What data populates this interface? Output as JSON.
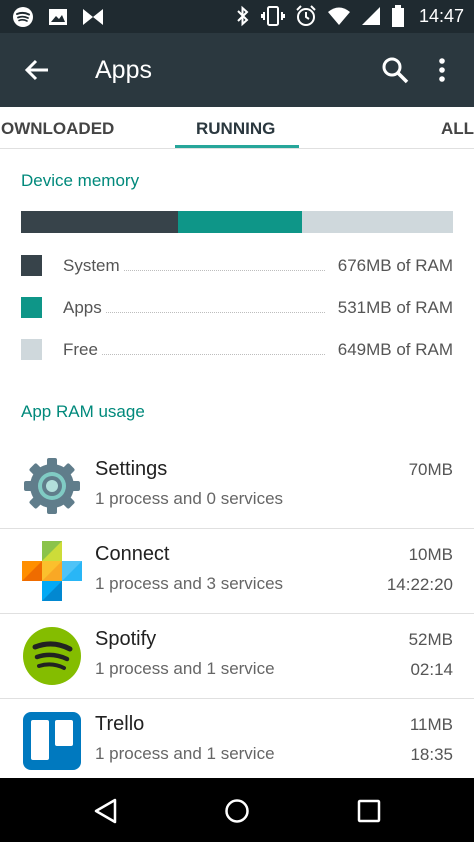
{
  "status_bar": {
    "time": "14:47",
    "left_icons": [
      "spotify-icon",
      "image-icon",
      "trello-notification-icon"
    ],
    "right_icons": [
      "bluetooth-icon",
      "vibrate-icon",
      "alarm-icon",
      "wifi-icon",
      "signal-icon",
      "battery-icon"
    ]
  },
  "toolbar": {
    "title": "Apps",
    "back_icon": "arrow-back-icon",
    "search_icon": "search-icon",
    "more_icon": "more-vert-icon"
  },
  "tabs": [
    {
      "label": "OWNLOADED"
    },
    {
      "label": "RUNNING"
    },
    {
      "label": "ALL"
    }
  ],
  "device_memory": {
    "title": "Device memory",
    "segments": [
      {
        "label": "System",
        "value": "676MB of RAM",
        "mb": 676,
        "color": "#37434a"
      },
      {
        "label": "Apps",
        "value": "531MB of RAM",
        "mb": 531,
        "color": "#0e9688"
      },
      {
        "label": "Free",
        "value": "649MB of RAM",
        "mb": 649,
        "color": "#cfd8dc"
      }
    ]
  },
  "app_ram_usage": {
    "title": "App RAM usage",
    "apps": [
      {
        "name": "Settings",
        "detail": "1 process and 0 services",
        "size": "70MB",
        "time": "",
        "icon": "settings-gear-icon"
      },
      {
        "name": "Connect",
        "detail": "1 process and 3 services",
        "size": "10MB",
        "time": "14:22:20",
        "icon": "connect-icon"
      },
      {
        "name": "Spotify",
        "detail": "1 process and 1 service",
        "size": "52MB",
        "time": "02:14",
        "icon": "spotify-icon"
      },
      {
        "name": "Trello",
        "detail": "1 process and 1 service",
        "size": "11MB",
        "time": "18:35",
        "icon": "trello-icon"
      }
    ]
  },
  "nav_bar": {
    "back_icon": "nav-back-icon",
    "home_icon": "nav-home-icon",
    "recents_icon": "nav-recents-icon"
  }
}
